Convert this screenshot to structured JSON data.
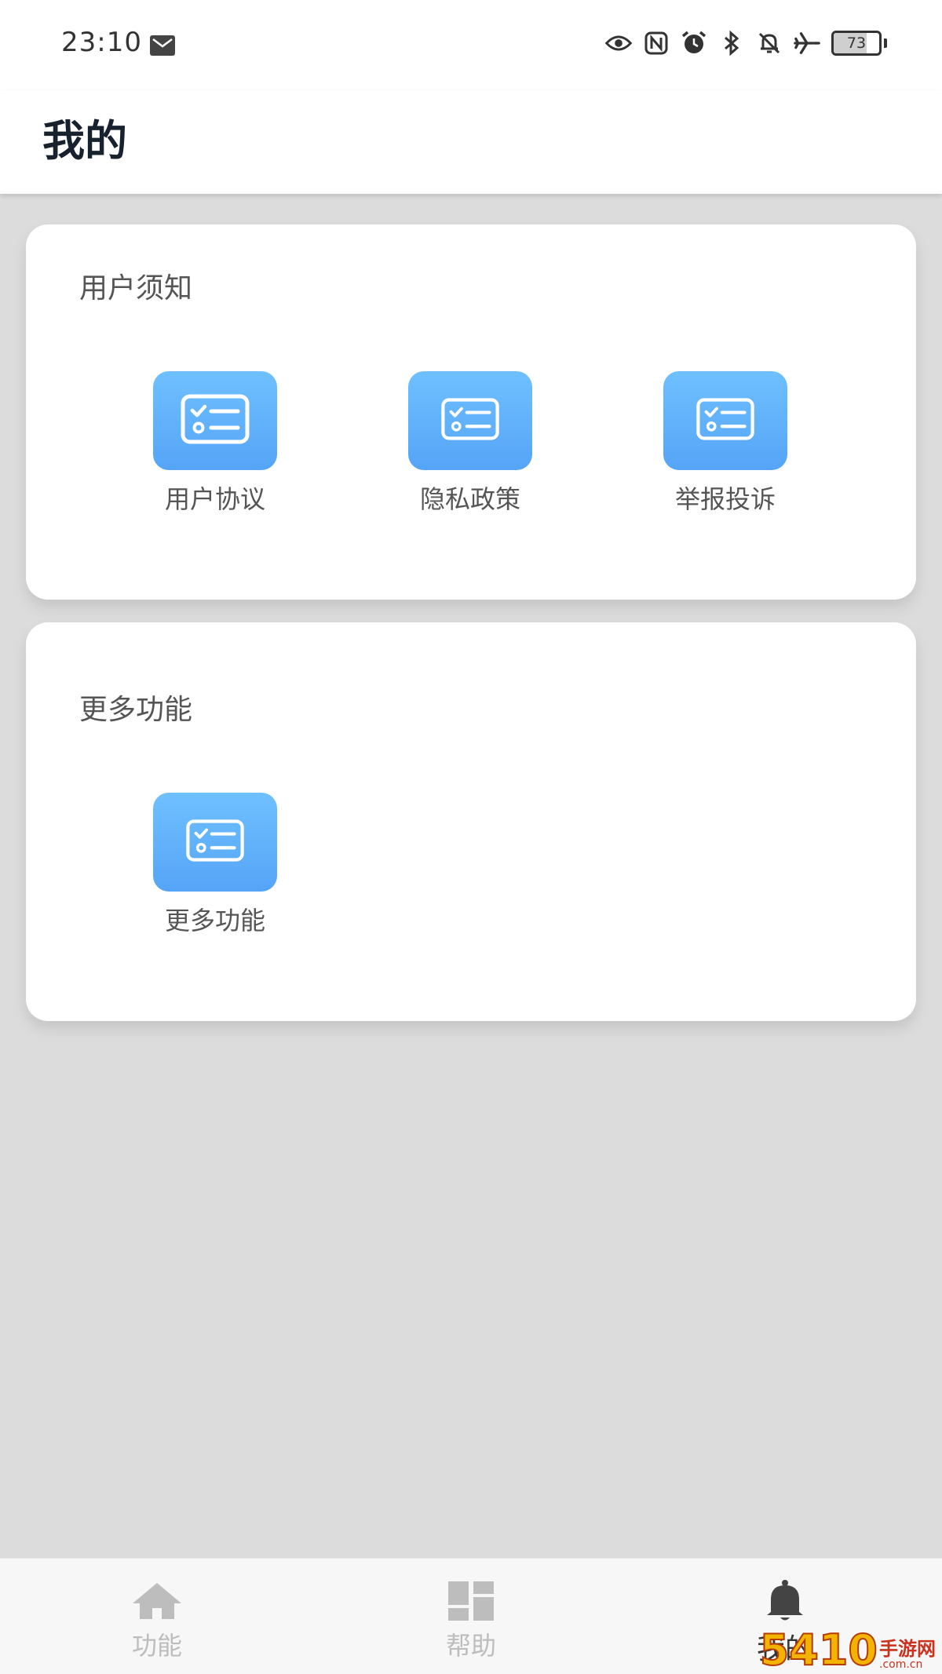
{
  "status_bar": {
    "time": "23:10",
    "battery_level": "73",
    "icons": [
      "message-icon",
      "eye-icon",
      "nfc-icon",
      "alarm-icon",
      "bluetooth-icon",
      "mute-icon",
      "airplane-icon",
      "battery-icon"
    ]
  },
  "header": {
    "title": "我的"
  },
  "cards": [
    {
      "title": "用户须知",
      "items": [
        {
          "label": "用户协议",
          "icon": "checklist-icon"
        },
        {
          "label": "隐私政策",
          "icon": "checklist-icon"
        },
        {
          "label": "举报投诉",
          "icon": "checklist-icon"
        }
      ]
    },
    {
      "title": "更多功能",
      "items": [
        {
          "label": "更多功能",
          "icon": "checklist-icon"
        }
      ]
    }
  ],
  "bottom_nav": {
    "items": [
      {
        "label": "功能",
        "icon": "home-icon",
        "active": false
      },
      {
        "label": "帮助",
        "icon": "dashboard-icon",
        "active": false
      },
      {
        "label": "我的",
        "icon": "bell-icon",
        "active": true
      }
    ]
  },
  "watermark": {
    "number": "5410",
    "text": "手游网",
    "domain": ".com.cn"
  },
  "colors": {
    "tile_gradient_top": "#6fc0ff",
    "tile_gradient_bottom": "#55a4f7",
    "page_background": "#dcdcdc",
    "title_text": "#18222e",
    "inactive_nav": "#bdbdbd",
    "active_nav": "#333333"
  }
}
